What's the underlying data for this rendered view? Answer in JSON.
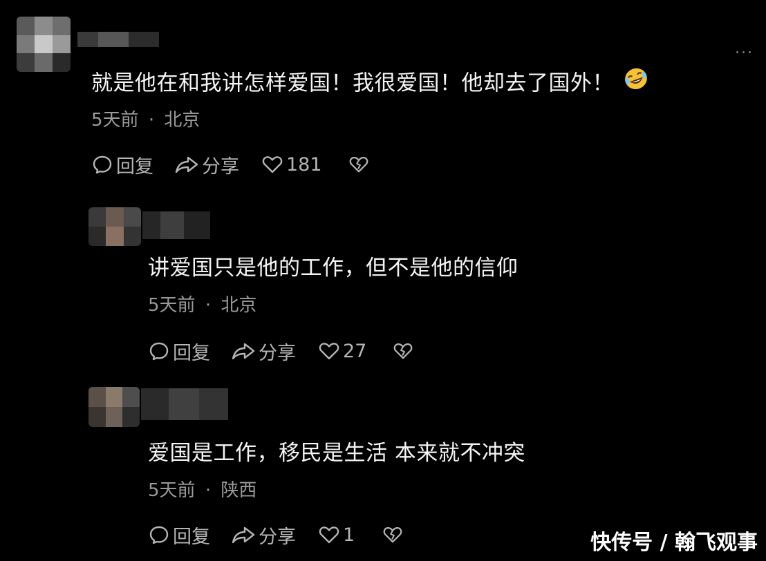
{
  "more_label": "...",
  "comments": [
    {
      "text": "就是他在和我讲怎样爱国！我很爱国！他却去了国外！",
      "emoji": "rolling-on-floor-laughing-emoji",
      "time": "5天前",
      "location": "北京",
      "reply_label": "回复",
      "share_label": "分享",
      "likes": "181"
    },
    {
      "text": "讲爱国只是他的工作，但不是他的信仰",
      "time": "5天前",
      "location": "北京",
      "reply_label": "回复",
      "share_label": "分享",
      "likes": "27"
    },
    {
      "text": "爱国是工作，移民是生活 本来就不冲突",
      "time": "5天前",
      "location": "陕西",
      "reply_label": "回复",
      "share_label": "分享",
      "likes": "1"
    }
  ],
  "meta_separator": "·",
  "watermark": "快传号 / 翰飞观事",
  "icons": [
    "reply-icon",
    "share-icon",
    "heart-icon",
    "dislike-heart-icon",
    "more-icon"
  ],
  "colors": {
    "background": "#000000",
    "text": "#f4f4f4",
    "meta": "#9b9b9b",
    "actions": "#b5b5b5"
  }
}
